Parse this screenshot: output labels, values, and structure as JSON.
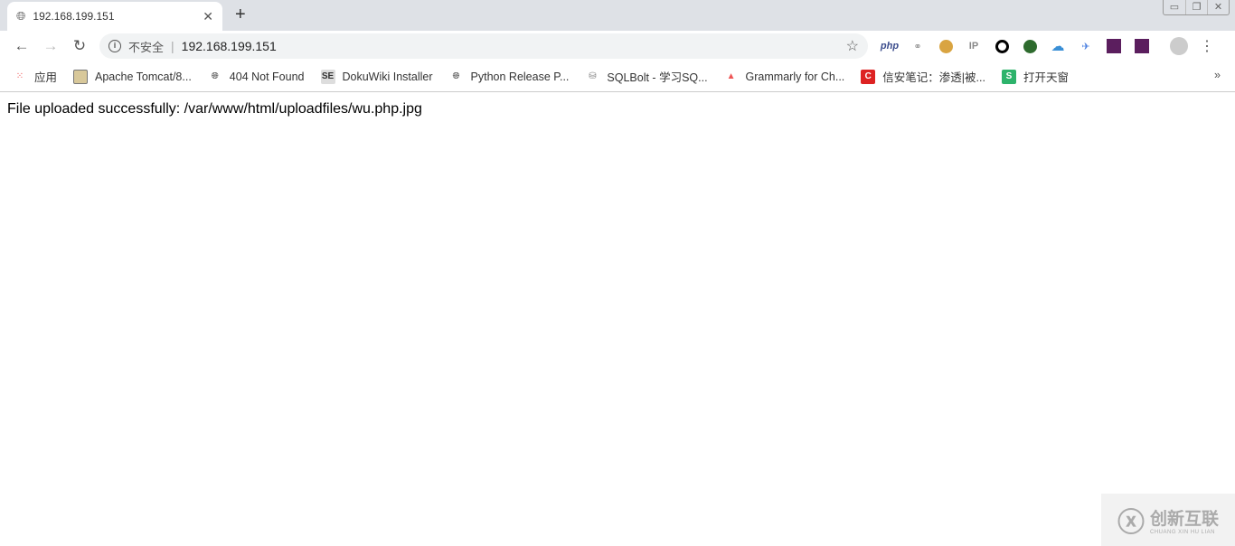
{
  "tab": {
    "title": "192.168.199.151"
  },
  "address": {
    "security": "不安全",
    "url": "192.168.199.151"
  },
  "extensions": [
    "php",
    "link",
    "cookie",
    "ip",
    "circle",
    "green",
    "cloud",
    "bird",
    "logo1",
    "logo2"
  ],
  "bookmarks": [
    {
      "label": "应用",
      "icon": "apps-grid-icon"
    },
    {
      "label": "Apache Tomcat/8...",
      "icon": "tomcat-icon"
    },
    {
      "label": "404 Not Found",
      "icon": "globe-icon"
    },
    {
      "label": "DokuWiki Installer",
      "icon": "se-icon"
    },
    {
      "label": "Python Release P...",
      "icon": "globe-icon"
    },
    {
      "label": "SQLBolt - 学习SQ...",
      "icon": "database-icon"
    },
    {
      "label": "Grammarly for Ch...",
      "icon": "grammarly-icon"
    },
    {
      "label": "信安笔记：渗透|被...",
      "icon": "c-icon"
    },
    {
      "label": "打开天窗",
      "icon": "s-icon"
    }
  ],
  "page": {
    "message": "File uploaded successfully: /var/www/html/uploadfiles/wu.php.jpg"
  },
  "watermark": {
    "cn": "创新互联",
    "en": "CHUANG XIN HU LIAN"
  }
}
